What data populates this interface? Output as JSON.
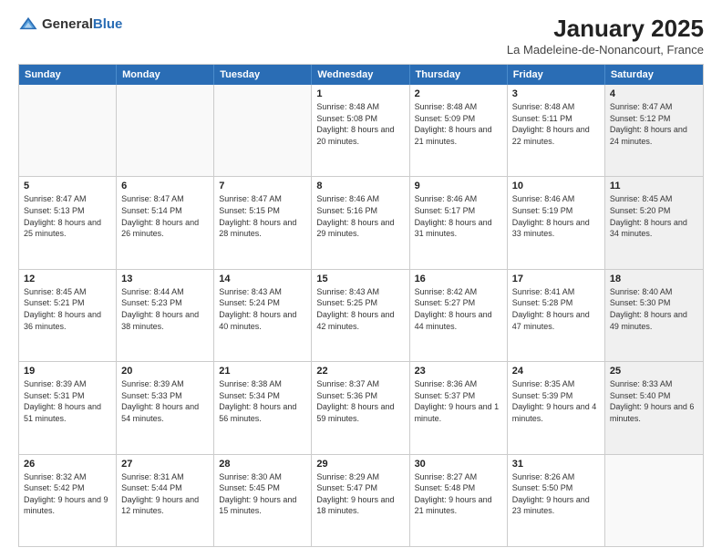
{
  "logo": {
    "general": "General",
    "blue": "Blue"
  },
  "header": {
    "month_year": "January 2025",
    "location": "La Madeleine-de-Nonancourt, France"
  },
  "days_of_week": [
    "Sunday",
    "Monday",
    "Tuesday",
    "Wednesday",
    "Thursday",
    "Friday",
    "Saturday"
  ],
  "weeks": [
    [
      {
        "day": "",
        "content": "",
        "shaded": false,
        "empty": true
      },
      {
        "day": "",
        "content": "",
        "shaded": false,
        "empty": true
      },
      {
        "day": "",
        "content": "",
        "shaded": false,
        "empty": true
      },
      {
        "day": "1",
        "content": "Sunrise: 8:48 AM\nSunset: 5:08 PM\nDaylight: 8 hours and 20 minutes.",
        "shaded": false,
        "empty": false
      },
      {
        "day": "2",
        "content": "Sunrise: 8:48 AM\nSunset: 5:09 PM\nDaylight: 8 hours and 21 minutes.",
        "shaded": false,
        "empty": false
      },
      {
        "day": "3",
        "content": "Sunrise: 8:48 AM\nSunset: 5:11 PM\nDaylight: 8 hours and 22 minutes.",
        "shaded": false,
        "empty": false
      },
      {
        "day": "4",
        "content": "Sunrise: 8:47 AM\nSunset: 5:12 PM\nDaylight: 8 hours and 24 minutes.",
        "shaded": true,
        "empty": false
      }
    ],
    [
      {
        "day": "5",
        "content": "Sunrise: 8:47 AM\nSunset: 5:13 PM\nDaylight: 8 hours and 25 minutes.",
        "shaded": false,
        "empty": false
      },
      {
        "day": "6",
        "content": "Sunrise: 8:47 AM\nSunset: 5:14 PM\nDaylight: 8 hours and 26 minutes.",
        "shaded": false,
        "empty": false
      },
      {
        "day": "7",
        "content": "Sunrise: 8:47 AM\nSunset: 5:15 PM\nDaylight: 8 hours and 28 minutes.",
        "shaded": false,
        "empty": false
      },
      {
        "day": "8",
        "content": "Sunrise: 8:46 AM\nSunset: 5:16 PM\nDaylight: 8 hours and 29 minutes.",
        "shaded": false,
        "empty": false
      },
      {
        "day": "9",
        "content": "Sunrise: 8:46 AM\nSunset: 5:17 PM\nDaylight: 8 hours and 31 minutes.",
        "shaded": false,
        "empty": false
      },
      {
        "day": "10",
        "content": "Sunrise: 8:46 AM\nSunset: 5:19 PM\nDaylight: 8 hours and 33 minutes.",
        "shaded": false,
        "empty": false
      },
      {
        "day": "11",
        "content": "Sunrise: 8:45 AM\nSunset: 5:20 PM\nDaylight: 8 hours and 34 minutes.",
        "shaded": true,
        "empty": false
      }
    ],
    [
      {
        "day": "12",
        "content": "Sunrise: 8:45 AM\nSunset: 5:21 PM\nDaylight: 8 hours and 36 minutes.",
        "shaded": false,
        "empty": false
      },
      {
        "day": "13",
        "content": "Sunrise: 8:44 AM\nSunset: 5:23 PM\nDaylight: 8 hours and 38 minutes.",
        "shaded": false,
        "empty": false
      },
      {
        "day": "14",
        "content": "Sunrise: 8:43 AM\nSunset: 5:24 PM\nDaylight: 8 hours and 40 minutes.",
        "shaded": false,
        "empty": false
      },
      {
        "day": "15",
        "content": "Sunrise: 8:43 AM\nSunset: 5:25 PM\nDaylight: 8 hours and 42 minutes.",
        "shaded": false,
        "empty": false
      },
      {
        "day": "16",
        "content": "Sunrise: 8:42 AM\nSunset: 5:27 PM\nDaylight: 8 hours and 44 minutes.",
        "shaded": false,
        "empty": false
      },
      {
        "day": "17",
        "content": "Sunrise: 8:41 AM\nSunset: 5:28 PM\nDaylight: 8 hours and 47 minutes.",
        "shaded": false,
        "empty": false
      },
      {
        "day": "18",
        "content": "Sunrise: 8:40 AM\nSunset: 5:30 PM\nDaylight: 8 hours and 49 minutes.",
        "shaded": true,
        "empty": false
      }
    ],
    [
      {
        "day": "19",
        "content": "Sunrise: 8:39 AM\nSunset: 5:31 PM\nDaylight: 8 hours and 51 minutes.",
        "shaded": false,
        "empty": false
      },
      {
        "day": "20",
        "content": "Sunrise: 8:39 AM\nSunset: 5:33 PM\nDaylight: 8 hours and 54 minutes.",
        "shaded": false,
        "empty": false
      },
      {
        "day": "21",
        "content": "Sunrise: 8:38 AM\nSunset: 5:34 PM\nDaylight: 8 hours and 56 minutes.",
        "shaded": false,
        "empty": false
      },
      {
        "day": "22",
        "content": "Sunrise: 8:37 AM\nSunset: 5:36 PM\nDaylight: 8 hours and 59 minutes.",
        "shaded": false,
        "empty": false
      },
      {
        "day": "23",
        "content": "Sunrise: 8:36 AM\nSunset: 5:37 PM\nDaylight: 9 hours and 1 minute.",
        "shaded": false,
        "empty": false
      },
      {
        "day": "24",
        "content": "Sunrise: 8:35 AM\nSunset: 5:39 PM\nDaylight: 9 hours and 4 minutes.",
        "shaded": false,
        "empty": false
      },
      {
        "day": "25",
        "content": "Sunrise: 8:33 AM\nSunset: 5:40 PM\nDaylight: 9 hours and 6 minutes.",
        "shaded": true,
        "empty": false
      }
    ],
    [
      {
        "day": "26",
        "content": "Sunrise: 8:32 AM\nSunset: 5:42 PM\nDaylight: 9 hours and 9 minutes.",
        "shaded": false,
        "empty": false
      },
      {
        "day": "27",
        "content": "Sunrise: 8:31 AM\nSunset: 5:44 PM\nDaylight: 9 hours and 12 minutes.",
        "shaded": false,
        "empty": false
      },
      {
        "day": "28",
        "content": "Sunrise: 8:30 AM\nSunset: 5:45 PM\nDaylight: 9 hours and 15 minutes.",
        "shaded": false,
        "empty": false
      },
      {
        "day": "29",
        "content": "Sunrise: 8:29 AM\nSunset: 5:47 PM\nDaylight: 9 hours and 18 minutes.",
        "shaded": false,
        "empty": false
      },
      {
        "day": "30",
        "content": "Sunrise: 8:27 AM\nSunset: 5:48 PM\nDaylight: 9 hours and 21 minutes.",
        "shaded": false,
        "empty": false
      },
      {
        "day": "31",
        "content": "Sunrise: 8:26 AM\nSunset: 5:50 PM\nDaylight: 9 hours and 23 minutes.",
        "shaded": false,
        "empty": false
      },
      {
        "day": "",
        "content": "",
        "shaded": true,
        "empty": true
      }
    ]
  ]
}
